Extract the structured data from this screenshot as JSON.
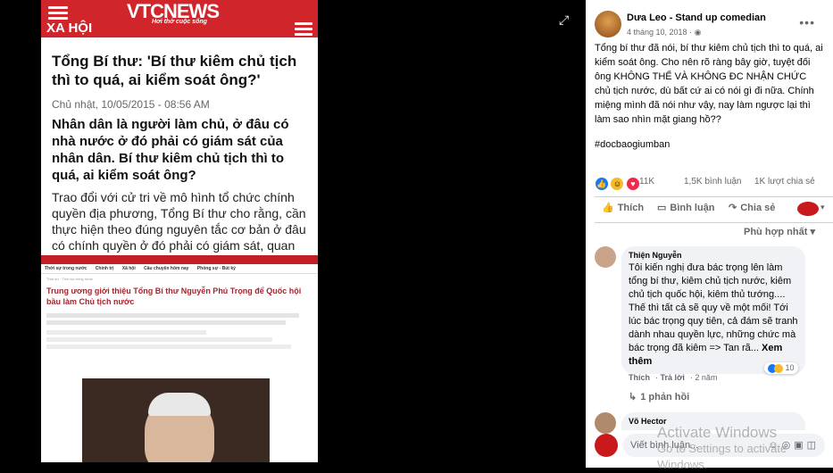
{
  "photo": {
    "site": {
      "logo": "VTCNEWS",
      "tagline": "Hơi thở cuộc sống",
      "section": "XA HỘI"
    },
    "article": {
      "title": "Tổng Bí thư: 'Bí thư kiêm chủ tịch thì to quá, ai kiểm soát ông?'",
      "date": "Chủ nhật, 10/05/2015 - 08:56 AM",
      "lead": "Nhân dân là người làm chủ, ở đâu có nhà nước ở đó phải có giám sát của nhân dân. Bí thư kiêm chủ tịch thì to quá, ai kiểm soát ông?",
      "body": "Trao đổi với cử tri về mô hình tổ chức chính quyền địa phương, Tổng Bí thư cho rằng, cần thực hiện theo đúng nguyên tắc cơ bản ở đâu có chính quyền ở đó phải có giám sát, quan trọng là làm sao giám sát phải có thực quyền."
    },
    "article2": {
      "tabs": [
        "Thời sự trong nước",
        "Chính trị",
        "Xã hội",
        "Câu chuyện hôm nay",
        "Phóng sự - Bút ký"
      ],
      "breadcrumb": "Thời sự · Thời sự trong nước",
      "title": "Trung ương giới thiệu Tổng Bí thư Nguyễn Phú Trọng để Quốc hội bầu làm Chủ tịch nước"
    }
  },
  "post": {
    "author": "Dưa Leo - Stand up comedian",
    "date": "4 tháng 10, 2018 · ",
    "text": "Tổng bí thư đã nói, bí thư kiêm chủ tịch thì to quá, ai kiểm soát ông. Cho nên rõ ràng bây giờ, tuyệt đối ông KHÔNG THỂ VÀ KHÔNG ĐC NHẬN CHỨC chủ tịch nước, dù bất cứ ai có nói gì đi nữa. Chính miệng mình đã nói như vậy, nay làm ngược lại thì làm sao nhìn mặt giang hồ??",
    "hashtag": "#docbaogiumban",
    "reaction_count": "11K",
    "comment_count": "1,5K bình luận",
    "share_count": "1K lượt chia sẻ",
    "actions": {
      "like": "Thích",
      "comment": "Bình luận",
      "share": "Chia sẻ"
    },
    "sort": "Phù hợp nhất"
  },
  "comments": [
    {
      "name": "Thiện Nguyễn",
      "text": "Tôi kiến nghị đưa bác trọng lên làm tổng bí thư, kiêm chủ tịch nước, kiêm chủ tịch quốc hội, kiêm thủ tướng.... Thế thì tất cả sẽ quy về một mối! Tới lúc bác trọng quy tiên, cả đám sẽ tranh dành nhau quyền lực, những chức mà bác trọng đã kiêm => Tan rã...",
      "more": "Xem thêm",
      "reactions": "10",
      "like": "Thích",
      "reply": "Trả lời",
      "time": "2 năm",
      "replies": "1 phản hồi"
    },
    {
      "name": "Võ Hector"
    }
  ],
  "composer": {
    "placeholder": "Viết bình luận..."
  },
  "watermark": {
    "line1": "Activate Windows",
    "line2": "Go to Settings to activate Windows."
  }
}
